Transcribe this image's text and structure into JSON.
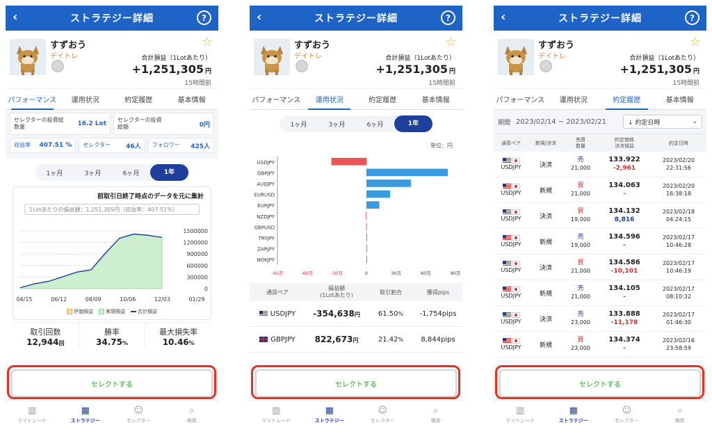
{
  "header": {
    "title": "ストラテジー詳細",
    "back": "‹",
    "help": "?"
  },
  "profile": {
    "name": "すずおう",
    "style": "デイトレ",
    "pl_label": "合計損益（1Lotあたり）",
    "pl_value": "+1,251,305",
    "pl_unit": "円",
    "updated": "15時間前"
  },
  "tabs": [
    "パフォーマンス",
    "運用状況",
    "約定履歴",
    "基本情報"
  ],
  "periods": [
    "1ヶ月",
    "3ヶ月",
    "6ヶ月",
    "1年"
  ],
  "performance": {
    "selector_qty_label": "セレクターの投資総数量",
    "selector_qty_value": "16.2 Lot",
    "selector_amt_label": "セレクターの投資総額",
    "selector_amt_value": "0円",
    "return_label": "収益率",
    "return_value": "407.51 %",
    "selectors_label": "セレクター",
    "selectors_value": "46人",
    "followers_label": "フォロワー",
    "followers_value": "425人",
    "chart_title": "前取引日終了時点のデータを元に集計",
    "chart_note": "1Lotあたりの損益額：1,251,305円（収益率：407.51%）",
    "legend": [
      "評価損益",
      "実現損益",
      "合計損益"
    ],
    "summary": [
      {
        "label": "取引回数",
        "value": "12,944",
        "unit": "回"
      },
      {
        "label": "勝率",
        "value": "34.75",
        "unit": "%"
      },
      {
        "label": "最大損失率",
        "value": "10.46",
        "unit": "%"
      }
    ]
  },
  "chart_data": [
    {
      "type": "area",
      "x": [
        "04/15",
        "06/12",
        "08/09",
        "10/06",
        "12/03",
        "01/29"
      ],
      "yticks": [
        0,
        300000,
        600000,
        900000,
        1200000,
        1500000
      ],
      "ylim": [
        0,
        1700000
      ],
      "series": [
        {
          "name": "実現損益",
          "values": [
            20000,
            120000,
            180000,
            300000,
            420000,
            480000,
            900000,
            1300000,
            1400000,
            1380000,
            1330000
          ]
        },
        {
          "name": "合計損益",
          "values": [
            25000,
            125000,
            190000,
            310000,
            430000,
            490000,
            920000,
            1310000,
            1420000,
            1390000,
            1330000
          ]
        }
      ],
      "legend_position": "bottom"
    },
    {
      "type": "bar",
      "orientation": "horizontal",
      "categories": [
        "USDJPY",
        "GBPJPY",
        "AUDJPY",
        "EURUSD",
        "EURJPY",
        "NZDJPY",
        "GBPUSD",
        "TRYJPY",
        "ZARJPY",
        "NOKJPY"
      ],
      "values": [
        -354638,
        822673,
        450000,
        240000,
        130000,
        -5000,
        -3000,
        2000,
        1000,
        500
      ],
      "xticks": [
        "-90万",
        "-60万",
        "-30万",
        "0",
        "30万",
        "60万",
        "90万"
      ],
      "xlim": [
        -900000,
        900000
      ],
      "unit": "単位：円"
    }
  ],
  "operation": {
    "unit": "単位：円",
    "table_headers": [
      "通貨ペア",
      "損益額\n(1Lotあたり)",
      "取引割合",
      "獲得pips"
    ],
    "rows": [
      {
        "pair": "USDJPY",
        "pl": "-354,638",
        "pl_unit": "円",
        "ratio": "61.50",
        "ratio_unit": "%",
        "pips": "-1,754pips",
        "flag": "us"
      },
      {
        "pair": "GBPJPY",
        "pl": "822,673",
        "pl_unit": "円",
        "ratio": "21.42",
        "ratio_unit": "%",
        "pips": "8,844pips",
        "flag": "gb"
      }
    ]
  },
  "history": {
    "period_label": "期間",
    "period_value": "2023/02/14 ~ 2023/02/21",
    "sort_label": "↓ 約定日時",
    "headers": [
      "通貨ペア",
      "新規/決済",
      "売買\n数量",
      "約定価格\n決済損益",
      "約定日時"
    ],
    "rows": [
      {
        "pair": "USDJPY",
        "type": "決済",
        "side": "売",
        "qty": "21,000",
        "price": "133.922",
        "pl": "-2,961",
        "date": "2023/02/20",
        "time": "22:31:56"
      },
      {
        "pair": "USDJPY",
        "type": "新規",
        "side": "買",
        "qty": "21,000",
        "price": "134.063",
        "pl": "-",
        "date": "2023/02/20",
        "time": "16:38:18"
      },
      {
        "pair": "USDJPY",
        "type": "決済",
        "side": "買",
        "qty": "19,000",
        "price": "134.132",
        "pl": "8,816",
        "date": "2023/02/18",
        "time": "04:24:15"
      },
      {
        "pair": "USDJPY",
        "type": "新規",
        "side": "売",
        "qty": "19,000",
        "price": "134.596",
        "pl": "-",
        "date": "2023/02/17",
        "time": "10:46:28"
      },
      {
        "pair": "USDJPY",
        "type": "決済",
        "side": "買",
        "qty": "21,000",
        "price": "134.586",
        "pl": "-10,101",
        "date": "2023/02/17",
        "time": "10:46:19"
      },
      {
        "pair": "USDJPY",
        "type": "新規",
        "side": "売",
        "qty": "21,000",
        "price": "134.105",
        "pl": "-",
        "date": "2023/02/17",
        "time": "08:10:32"
      },
      {
        "pair": "USDJPY",
        "type": "決済",
        "side": "売",
        "qty": "23,000",
        "price": "133.888",
        "pl": "-11,178",
        "date": "2023/02/17",
        "time": "01:46:30"
      },
      {
        "pair": "USDJPY",
        "type": "新規",
        "side": "買",
        "qty": "23,000",
        "price": "134.374",
        "pl": "-",
        "date": "2023/02/16",
        "time": "23:58:59"
      }
    ]
  },
  "select_button": "セレクトする",
  "bottom_nav": [
    "マイトレード",
    "ストラテジー",
    "セレクター",
    "検索"
  ]
}
